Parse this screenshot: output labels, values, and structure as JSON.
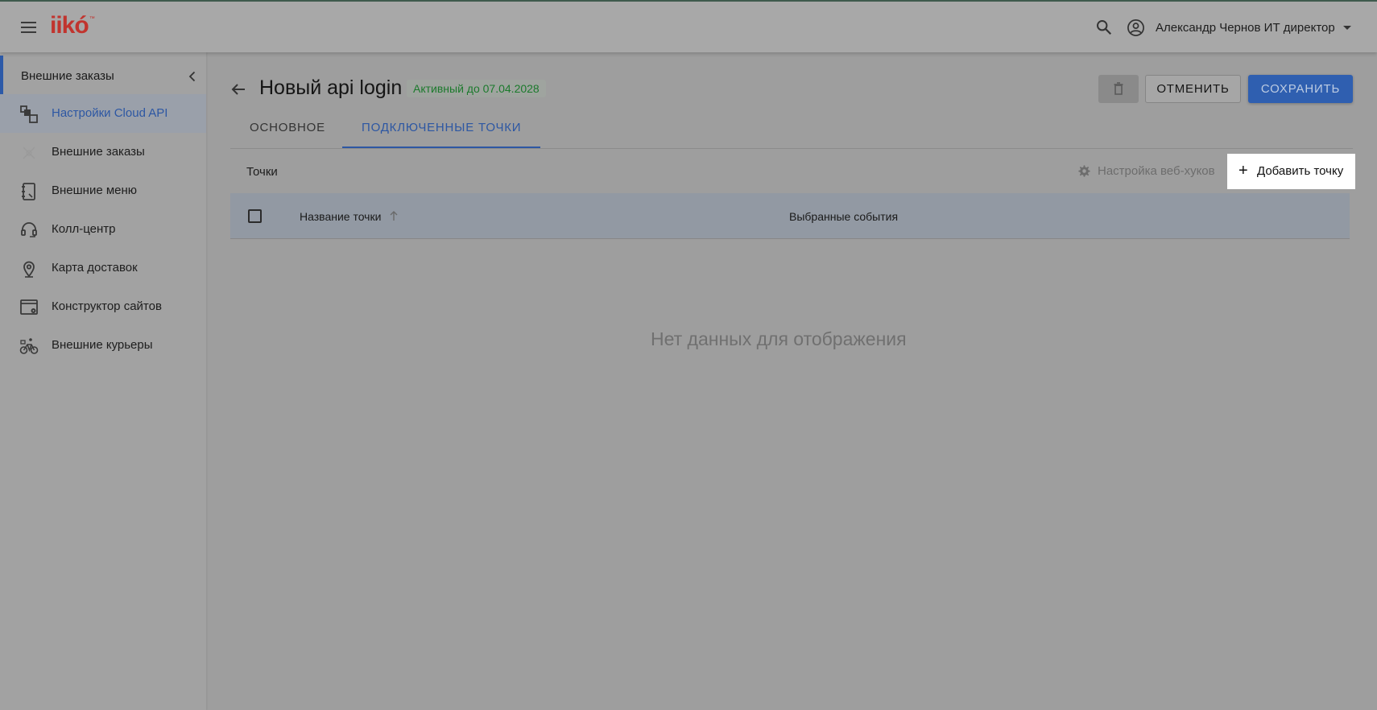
{
  "header": {
    "logo": "iikó",
    "logo_tm": "™",
    "user_name": "Александр Чернов ИТ директор"
  },
  "sidebar": {
    "section_label": "Внешние заказы",
    "items": [
      {
        "label": "Настройки Cloud API",
        "icon": "cloud-api-icon",
        "active": true
      },
      {
        "label": "Внешние заказы",
        "icon": "external-orders-icon",
        "active": false
      },
      {
        "label": "Внешние меню",
        "icon": "external-menu-icon",
        "active": false
      },
      {
        "label": "Колл-центр",
        "icon": "headset-icon",
        "active": false
      },
      {
        "label": "Карта доставок",
        "icon": "map-pin-icon",
        "active": false
      },
      {
        "label": "Конструктор сайтов",
        "icon": "site-builder-icon",
        "active": false
      },
      {
        "label": "Внешние курьеры",
        "icon": "bicycle-icon",
        "active": false
      }
    ]
  },
  "page": {
    "title": "Новый api login",
    "status": "Активный до 07.04.2028",
    "cancel_label": "ОТМЕНИТЬ",
    "save_label": "СОХРАНИТЬ"
  },
  "tabs": [
    {
      "label": "ОСНОВНОЕ",
      "active": false
    },
    {
      "label": "ПОДКЛЮЧЕННЫЕ ТОЧКИ",
      "active": true
    }
  ],
  "points": {
    "section_label": "Точки",
    "webhook_label": "Настройка веб-хуков",
    "add_label": "Добавить точку",
    "columns": [
      "Название точки",
      "Выбранные события"
    ],
    "empty_text": "Нет данных для отображения"
  },
  "colors": {
    "accent": "#2d57a3",
    "logo": "#c1342e",
    "status": "#1b7a2c"
  }
}
